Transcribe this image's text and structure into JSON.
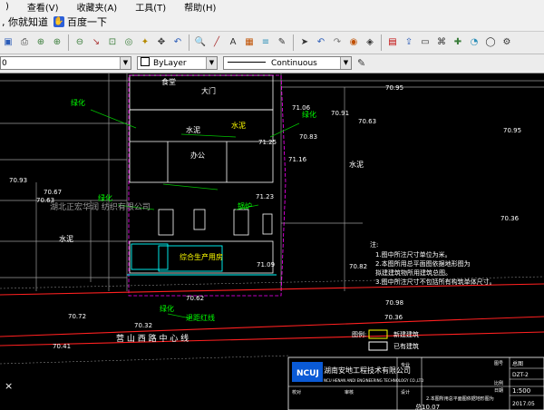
{
  "menu": {
    "items": [
      ")",
      "查看(V)",
      "收藏夹(A)",
      "工具(T)",
      "帮助(H)"
    ]
  },
  "linkbar": {
    "hint": ", 你就知道",
    "baidu_label": "百度一下"
  },
  "toolbar": {
    "icons": [
      "save-icon",
      "print-icon",
      "zoom-window-icon",
      "zoom-in-icon",
      "zoom-out-icon",
      "measure-icon",
      "zoom-extent-icon",
      "zoom-realtime-icon",
      "light-bulb-icon",
      "pan-icon",
      "zoom-previous-icon",
      "magnify-icon",
      "line-icon",
      "text-icon",
      "color-icon",
      "layer-icon",
      "pen-icon",
      "select-icon",
      "undo-icon",
      "redo-icon",
      "shade-icon",
      "render-icon",
      "pdf-icon",
      "export-icon",
      "print-preview-icon",
      "bookmark-icon",
      "tools-icon",
      "chart-icon",
      "shapes-icon",
      "settings-icon"
    ]
  },
  "properties": {
    "layer_value": "0",
    "color_value": "ByLayer",
    "linetype_value": "Continuous"
  },
  "drawing": {
    "company": "湖南安地工程技术有限公司",
    "company_en": "NCU HENAN ANDI ENGINEERING TECHNOLOGY CO.,LTD",
    "logo_text": "NCUJ",
    "notes_title": "注:",
    "notes": [
      "1.图中所注尺寸单位为米。",
      "2.本图所用总平面图依据地形图为",
      "拟建建筑物所用建筑总图。",
      "3.图中所注尺寸不包括所有构筑单体尺寸。"
    ],
    "legend_label": "图例:",
    "legend_new": "新建建筑",
    "legend_existing": "已有建筑",
    "road_name": "营 山 西 路 中 心 线",
    "left_building": "湖北正宏华润 纺织有限公司",
    "labels": [
      "食堂",
      "大门",
      "办公",
      "水泥",
      "水泥",
      "水泥",
      "绿化",
      "绿化",
      "绿化",
      "退距红线",
      "绿化",
      "锅炉",
      "综合生产用房",
      "水泥"
    ],
    "elevations": [
      "70.95",
      "70.67",
      "70.63",
      "70.63",
      "70.95",
      "70.62",
      "70.98",
      "70.72",
      "70.41",
      "70.36",
      "70.32",
      "70.36",
      "70.93",
      "70.91",
      "70.83",
      "71.06",
      "71.25",
      "71.23",
      "71.09",
      "71.16",
      "70.82"
    ],
    "tb_fields": [
      "专业",
      "设计",
      "校对",
      "审核",
      "图号",
      "日期",
      "比例"
    ],
    "tb_values": [
      "总图",
      "DZT-2",
      "1:500",
      "2017.05"
    ],
    "scale_readout": "1:500",
    "axis_marks": [
      "×",
      "总10.07"
    ]
  }
}
